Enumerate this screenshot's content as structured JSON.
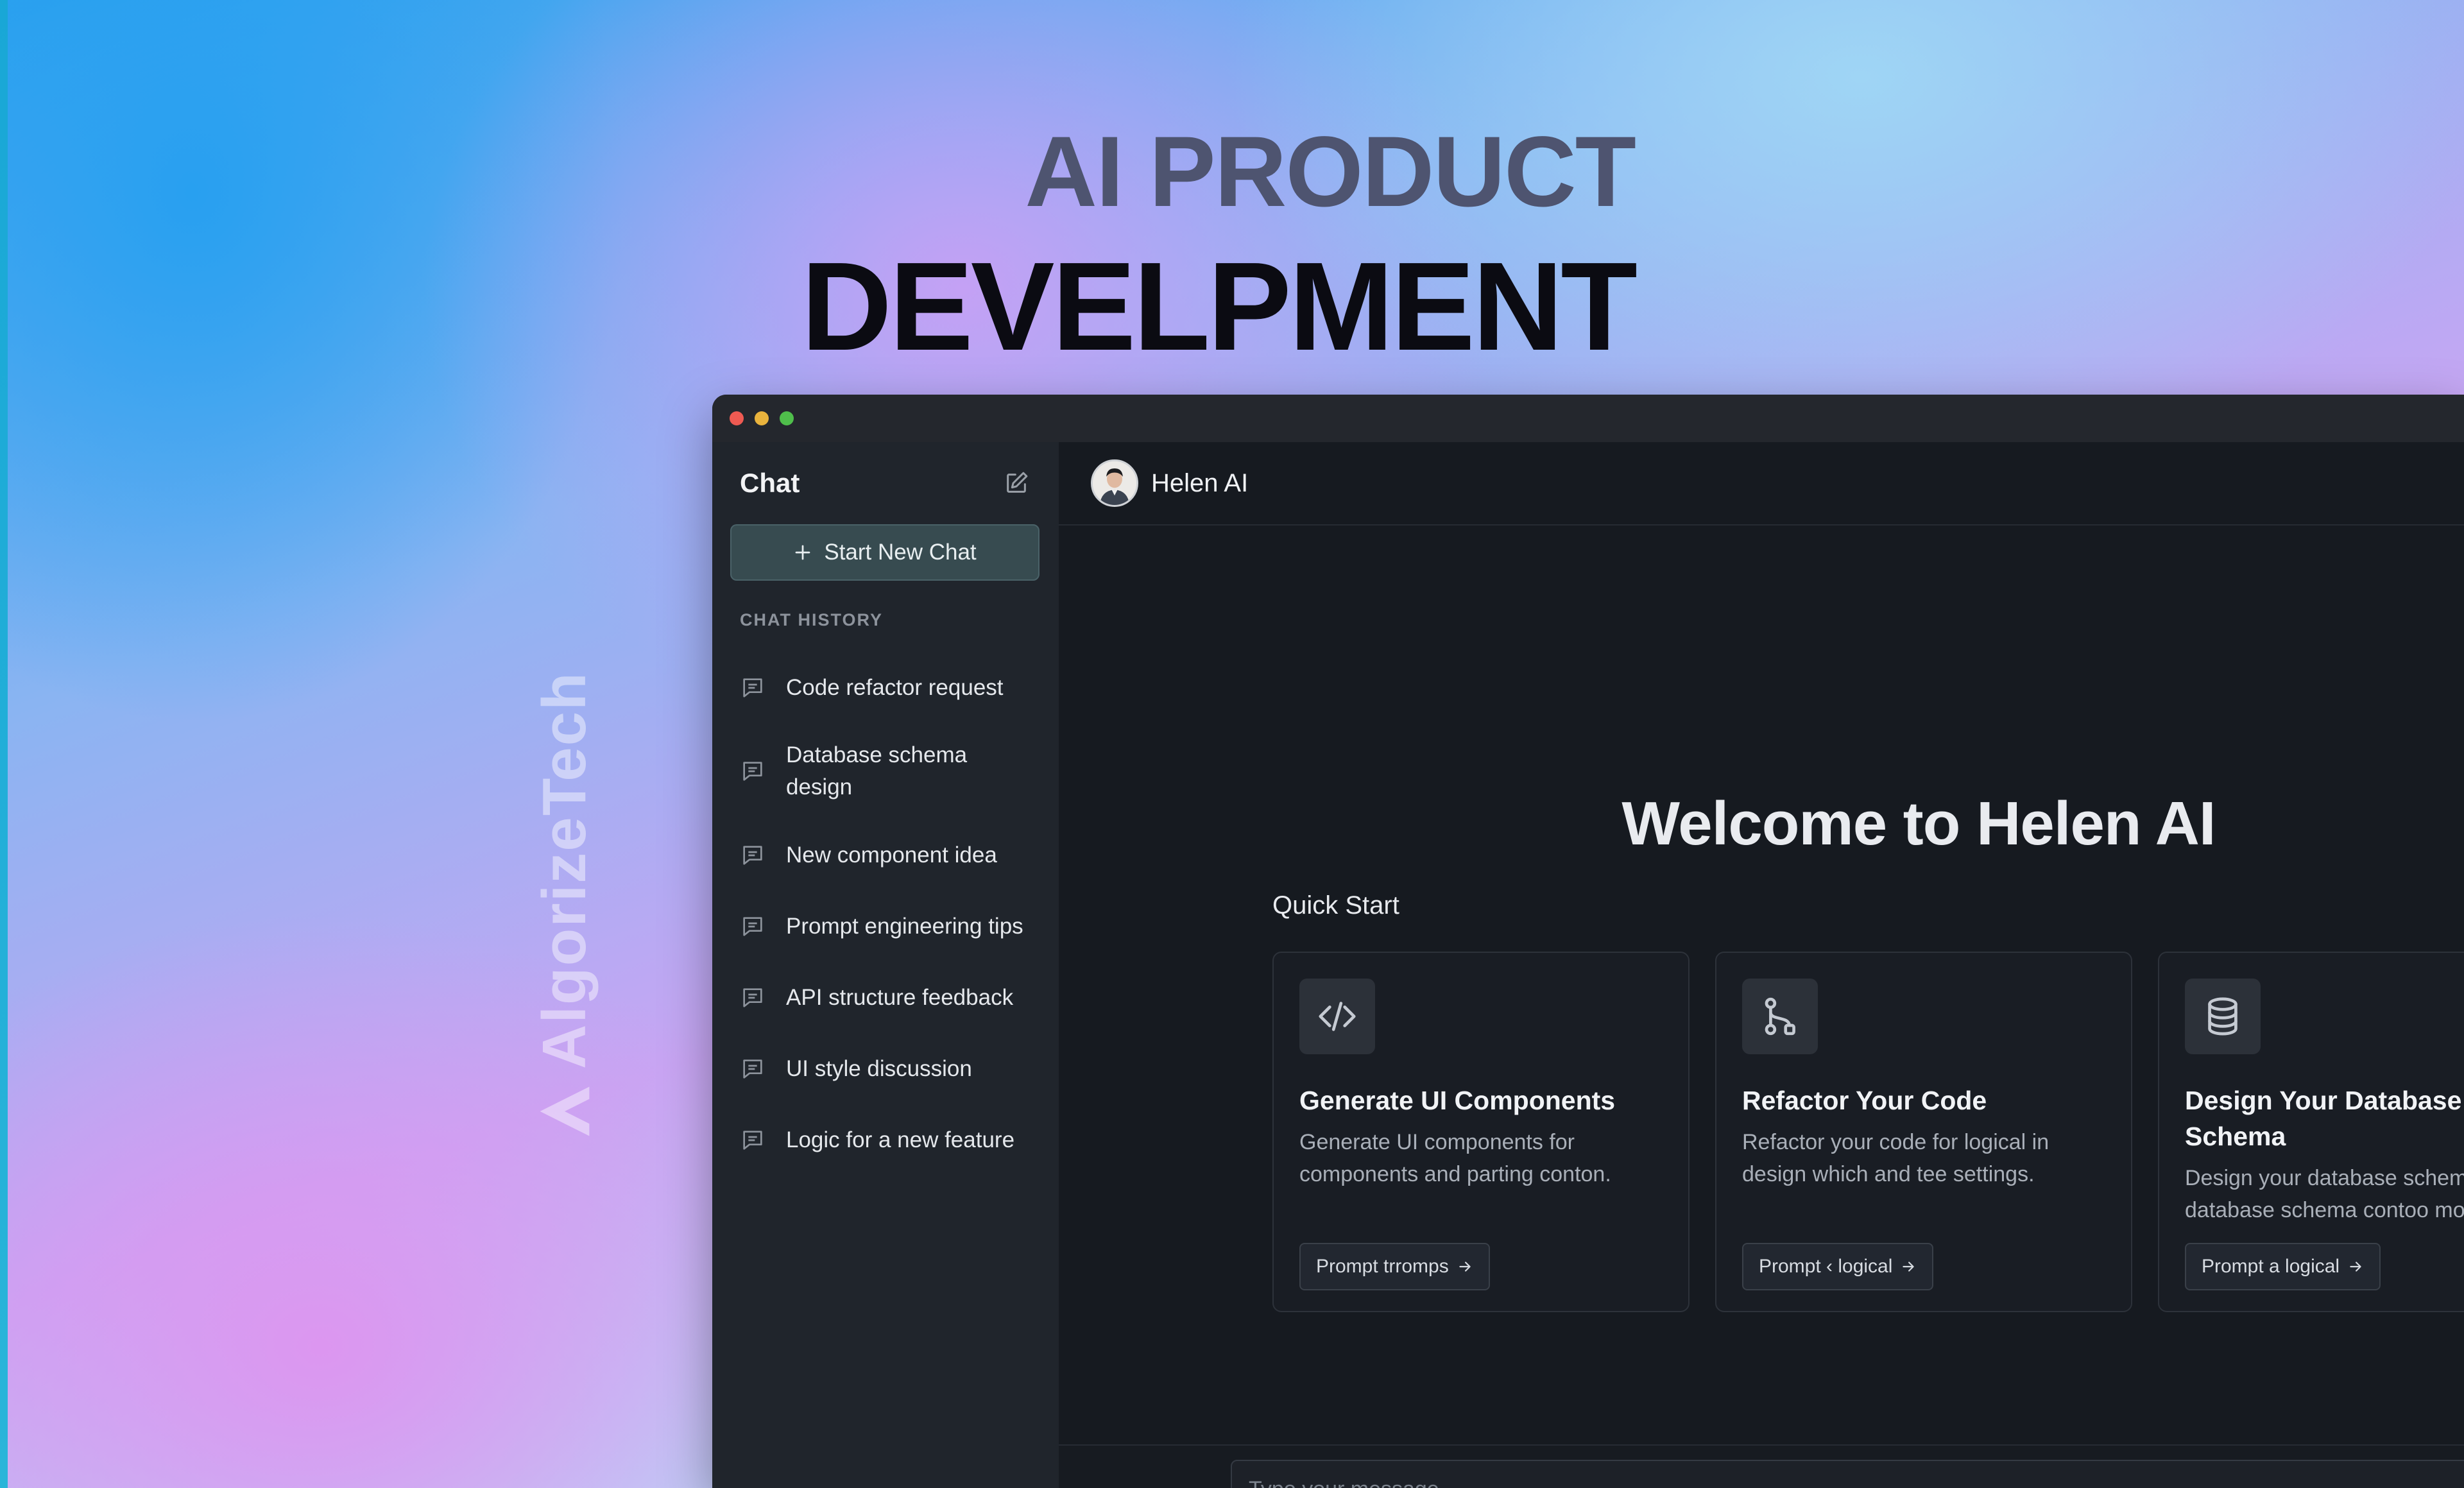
{
  "hero": {
    "line1": "AI PRODUCT",
    "line2": "DEVELPMENT"
  },
  "watermark": {
    "text": "AlgorizeTech"
  },
  "sidebar": {
    "title": "Chat",
    "edit_icon": "edit-icon",
    "new_chat_label": "Start New Chat",
    "history_label": "CHAT HISTORY",
    "items": [
      {
        "label": "Code refactor request"
      },
      {
        "label": "Database schema design"
      },
      {
        "label": "New component idea"
      },
      {
        "label": "Prompt engineering tips"
      },
      {
        "label": "API structure feedback"
      },
      {
        "label": "UI style discussion"
      },
      {
        "label": "Logic for a new feature"
      }
    ]
  },
  "header": {
    "assistant_name": "Helen AI"
  },
  "main": {
    "welcome": "Welcome to Helen AI",
    "quick_start": "Quick Start",
    "cards": [
      {
        "icon": "code-icon",
        "title": "Generate UI Components",
        "description": "Generate UI components for components and parting conton.",
        "button": "Prompt trromps"
      },
      {
        "icon": "git-branch-icon",
        "title": "Refactor Your Code",
        "description": "Refactor your code for logical in design which and tee settings.",
        "button": "Prompt ‹ logical"
      },
      {
        "icon": "database-icon",
        "title": "Design Your Database Schema",
        "description": "Design your database schema database schema contoo more",
        "button": "Prompt a logical"
      }
    ]
  },
  "composer": {
    "placeholder": "Typo your message..."
  },
  "colors": {
    "accent_button": "#374b50",
    "window_bg": "#161a20",
    "sidebar_bg": "#20252c"
  }
}
